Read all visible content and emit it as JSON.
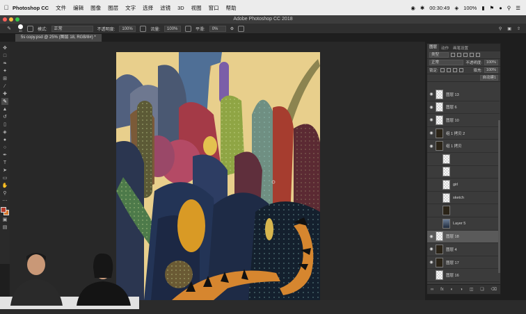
{
  "menubar": {
    "app_name": "Photoshop CC",
    "items": [
      "文件",
      "编辑",
      "图像",
      "图层",
      "文字",
      "选择",
      "滤镜",
      "3D",
      "视图",
      "窗口",
      "帮助"
    ],
    "clock": "00:30:49",
    "battery": "100%",
    "apple_icon": "apple-icon"
  },
  "window": {
    "title": "Adobe Photoshop CC 2018",
    "traffic": [
      "#fc605b",
      "#fdbc40",
      "#34c84a"
    ]
  },
  "options": {
    "brush_size": "40",
    "mode_label": "模式:",
    "mode_value": "正常",
    "opacity_label": "不透明度:",
    "opacity_value": "100%",
    "flow_label": "流量:",
    "flow_value": "100%",
    "smooth_label": "平滑:",
    "smooth_value": "0%"
  },
  "document": {
    "tab_label": "5s copy.psd @ 25% (图层 18, RGB/8#) *"
  },
  "tools": [
    "move-icon",
    "marquee-icon",
    "lasso-icon",
    "magic-wand-icon",
    "crop-icon",
    "eyedropper-icon",
    "healing-icon",
    "brush-icon",
    "stamp-icon",
    "history-brush-icon",
    "eraser-icon",
    "bucket-icon",
    "blur-icon",
    "dodge-icon",
    "pen-icon",
    "type-icon",
    "path-select-icon",
    "shape-icon",
    "hand-icon",
    "zoom-icon",
    "more-icon"
  ],
  "colors": {
    "foreground": "#b23b2a",
    "background": "#d9792c"
  },
  "layers_panel": {
    "tabs": [
      "图层",
      "动作",
      "画笔设置"
    ],
    "filter_label": "类型",
    "blend_mode": "正常",
    "opacity_label": "不透明度:",
    "opacity_value": "100%",
    "lock_label": "锁定:",
    "fill_label": "填充:",
    "fill_value": "100%",
    "auto_label": "自动建1",
    "layers": [
      {
        "name": "图层 13",
        "visible": true,
        "indent": false,
        "thumb": "checker"
      },
      {
        "name": "图层 6",
        "visible": true,
        "indent": false,
        "thumb": "checker"
      },
      {
        "name": "图层 10",
        "visible": true,
        "indent": false,
        "thumb": "checker"
      },
      {
        "name": "组 1 拷贝 2",
        "visible": true,
        "indent": false,
        "thumb": "dark"
      },
      {
        "name": "组 1 拷贝",
        "visible": true,
        "indent": false,
        "thumb": "dark"
      },
      {
        "name": "",
        "visible": false,
        "indent": true,
        "thumb": "checker"
      },
      {
        "name": "",
        "visible": false,
        "indent": true,
        "thumb": "checker"
      },
      {
        "name": "girl",
        "visible": false,
        "indent": true,
        "thumb": "checker"
      },
      {
        "name": "sketch",
        "visible": false,
        "indent": true,
        "thumb": "checker"
      },
      {
        "name": "",
        "visible": false,
        "indent": true,
        "thumb": "dark"
      },
      {
        "name": "Layer 5",
        "visible": false,
        "indent": true,
        "thumb": "art"
      },
      {
        "name": "图层 18",
        "visible": true,
        "indent": false,
        "thumb": "checker",
        "selected": true
      },
      {
        "name": "图层 4",
        "visible": true,
        "indent": false,
        "thumb": "dark"
      },
      {
        "name": "图层 17",
        "visible": true,
        "indent": false,
        "thumb": "dark"
      },
      {
        "name": "图层 16",
        "visible": false,
        "indent": false,
        "thumb": "checker"
      }
    ],
    "footer_icons": [
      "link-icon",
      "fx-icon",
      "mask-icon",
      "adjustment-icon",
      "folder-icon",
      "new-layer-icon",
      "trash-icon"
    ]
  }
}
